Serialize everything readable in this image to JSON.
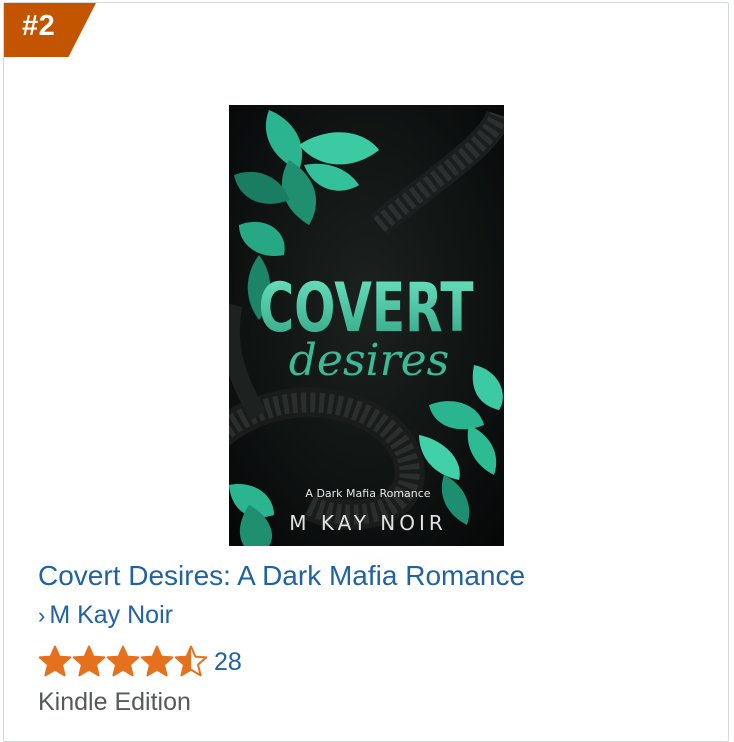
{
  "rank": "#2",
  "product": {
    "title": "Covert Desires: A Dark Mafia Romance",
    "author": "M Kay Noir",
    "rating": 4.5,
    "rating_max": 5,
    "rating_count": "28",
    "format": "Kindle Edition",
    "cover": {
      "title_line1": "COVERT",
      "title_line2": "desires",
      "tagline": "A Dark Mafia Romance",
      "author": "M KAY NOIR"
    }
  },
  "colors": {
    "badge": "#c45500",
    "link": "#2162a1",
    "star": "#e6711c",
    "muted_text": "#565959",
    "cover_accent": "#4fd6b0"
  },
  "icons": {
    "author_chevron": "chevron-right-icon",
    "rating": "star-icon"
  }
}
